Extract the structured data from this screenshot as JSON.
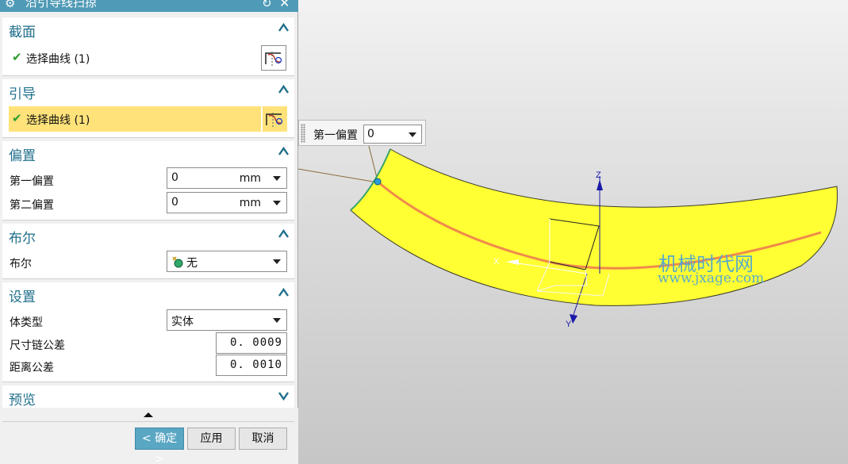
{
  "dialog": {
    "title": "沿引导线扫掠",
    "icons": {
      "settings": "gear-icon",
      "reset": "reset-icon",
      "close": "close-icon"
    }
  },
  "sections": {
    "section": {
      "title": "截面",
      "select_curve": "选择曲线 (1)"
    },
    "guide": {
      "title": "引导",
      "select_curve": "选择曲线 (1)"
    },
    "offset": {
      "title": "偏置",
      "first_offset_label": "第一偏置",
      "first_offset_value": "0",
      "first_offset_unit": "mm",
      "second_offset_label": "第二偏置",
      "second_offset_value": "0",
      "second_offset_unit": "mm"
    },
    "boolean": {
      "title": "布尔",
      "label": "布尔",
      "value": "无"
    },
    "settings": {
      "title": "设置",
      "body_type_label": "体类型",
      "body_type_value": "实体",
      "chain_tol_label": "尺寸链公差",
      "chain_tol_value": "0. 0009",
      "dist_tol_label": "距离公差",
      "dist_tol_value": "0. 0010"
    },
    "preview": {
      "title": "预览"
    }
  },
  "buttons": {
    "ok": "< 确定 >",
    "apply": "应用",
    "cancel": "取消"
  },
  "floating": {
    "label": "第一偏置",
    "value": "0"
  },
  "axes": {
    "z": "Z",
    "x": "X",
    "y": "Y"
  },
  "watermark": {
    "cn": "机械时代网",
    "en": "www.jxage.com"
  },
  "colors": {
    "accent": "#1f6f8b",
    "titlebar": "#4f9ab6",
    "highlight": "#ffe37a",
    "surface": "#ffff33",
    "guide_curve": "#f08a4b"
  }
}
